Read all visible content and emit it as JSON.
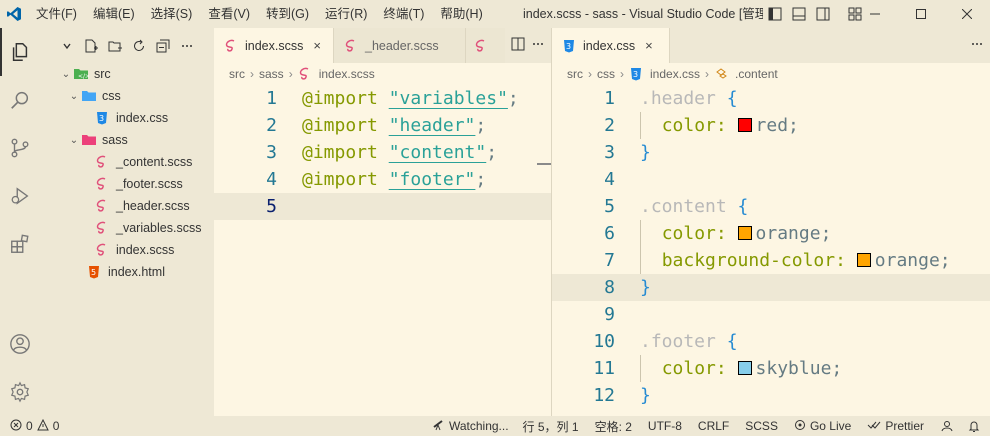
{
  "titlebar": {
    "menu": [
      "文件(F)",
      "编辑(E)",
      "选择(S)",
      "查看(V)",
      "转到(G)",
      "运行(R)",
      "终端(T)",
      "帮助(H)"
    ],
    "window_title": "index.scss - sass - Visual Studio Code [管理..."
  },
  "sidebar": {
    "tree": [
      {
        "label": "src",
        "type": "folder",
        "open": true,
        "depth": 0
      },
      {
        "label": "css",
        "type": "folder-css",
        "open": true,
        "depth": 1
      },
      {
        "label": "index.css",
        "type": "css",
        "depth": 2
      },
      {
        "label": "sass",
        "type": "folder-sass",
        "open": true,
        "depth": 1
      },
      {
        "label": "_content.scss",
        "type": "scss",
        "depth": 2
      },
      {
        "label": "_footer.scss",
        "type": "scss",
        "depth": 2
      },
      {
        "label": "_header.scss",
        "type": "scss",
        "depth": 2
      },
      {
        "label": "_variables.scss",
        "type": "scss",
        "depth": 2
      },
      {
        "label": "index.scss",
        "type": "scss",
        "depth": 2
      },
      {
        "label": "index.html",
        "type": "html",
        "depth": 1
      }
    ]
  },
  "left_editor": {
    "tabs": [
      {
        "label": "index.scss",
        "active": true,
        "close": "×"
      },
      {
        "label": "_header.scss",
        "active": false
      }
    ],
    "breadcrumb": [
      "src",
      "sass",
      "index.scss"
    ],
    "line_numbers": [
      "1",
      "2",
      "3",
      "4",
      "5"
    ],
    "lines": [
      {
        "kw": "@import",
        "str": "\"variables\"",
        "end": ";"
      },
      {
        "kw": "@import",
        "str": "\"header\"",
        "end": ";"
      },
      {
        "kw": "@import",
        "str": "\"content\"",
        "end": ";"
      },
      {
        "kw": "@import",
        "str": "\"footer\"",
        "end": ";"
      }
    ]
  },
  "right_editor": {
    "tabs": [
      {
        "label": "index.css",
        "active": true,
        "close": "×"
      }
    ],
    "breadcrumb": [
      "src",
      "css",
      "index.css",
      ".content"
    ],
    "line_numbers": [
      "1",
      "2",
      "3",
      "4",
      "5",
      "6",
      "7",
      "8",
      "9",
      "10",
      "11",
      "12"
    ],
    "header_sel": ".header",
    "content_sel": ".content",
    "footer_sel": ".footer",
    "open_brace": "{",
    "close_brace": "}",
    "prop_color": "color: ",
    "prop_bg": "background-color: ",
    "val_red": "red;",
    "val_orange": "orange;",
    "val_skyblue": "skyblue;",
    "colors": {
      "red": "#ff0000",
      "orange": "#ffa500",
      "skyblue": "#87ceeb"
    }
  },
  "statusbar": {
    "errors": "0",
    "warnings": "0",
    "watching": "Watching...",
    "position": "行 5，列 1",
    "spaces": "空格: 2",
    "encoding": "UTF-8",
    "eol": "CRLF",
    "language": "SCSS",
    "golive": "Go Live",
    "prettier": "Prettier"
  },
  "theme": {
    "accent": "#268bd2",
    "background": "#fdf6e3",
    "chrome": "#eee8d5"
  }
}
